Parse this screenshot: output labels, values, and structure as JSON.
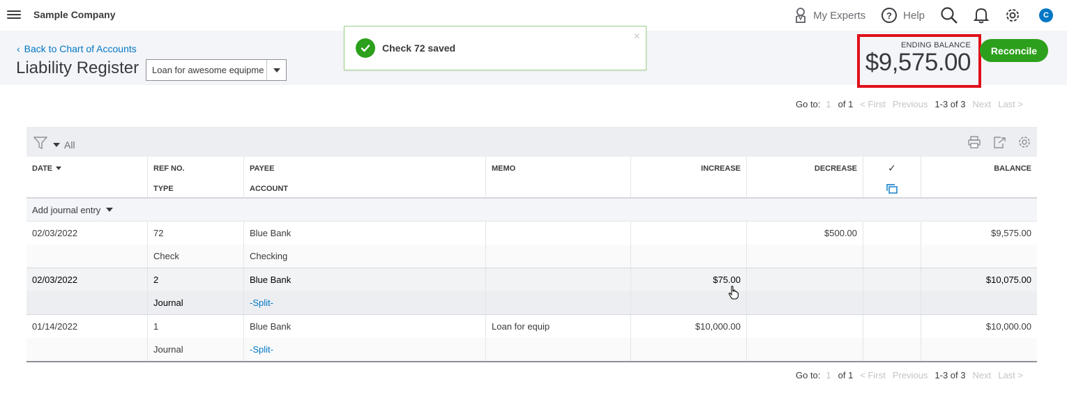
{
  "topbar": {
    "company": "Sample Company",
    "my_experts": "My Experts",
    "help": "Help",
    "avatar_letter": "C"
  },
  "header": {
    "back_link": "Back to Chart of Accounts",
    "title": "Liability Register",
    "account_value": "Loan for awesome equipme"
  },
  "toast": {
    "message": "Check 72 saved",
    "close": "×"
  },
  "balance": {
    "caption": "ENDING BALANCE",
    "amount": "$9,575.00"
  },
  "reconcile_label": "Reconcile",
  "pager": {
    "goto": "Go to:",
    "page": "1",
    "of": "of 1",
    "first": "< First",
    "previous": "Previous",
    "range": "1-3 of 3",
    "next": "Next",
    "last": "Last >"
  },
  "filter": {
    "label": "All"
  },
  "columns": {
    "date": "DATE",
    "ref": "REF NO.",
    "type": "TYPE",
    "payee": "PAYEE",
    "account": "ACCOUNT",
    "memo": "MEMO",
    "increase": "INCREASE",
    "decrease": "DECREASE",
    "check": "✓",
    "balance": "BALANCE"
  },
  "add_journal": "Add journal entry",
  "transactions": [
    {
      "date": "02/03/2022",
      "ref": "72",
      "type": "Check",
      "payee": "Blue Bank",
      "account": "Checking",
      "memo": "",
      "increase": "",
      "decrease": "$500.00",
      "balance": "$9,575.00"
    },
    {
      "date": "02/03/2022",
      "ref": "2",
      "type": "Journal",
      "payee": "Blue Bank",
      "account": "-Split-",
      "memo": "",
      "increase": "$75.00",
      "decrease": "",
      "balance": "$10,075.00"
    },
    {
      "date": "01/14/2022",
      "ref": "1",
      "type": "Journal",
      "payee": "Blue Bank",
      "account": "-Split-",
      "memo": "Loan for equip",
      "increase": "$10,000.00",
      "decrease": "",
      "balance": "$10,000.00"
    }
  ],
  "colors": {
    "accent_green": "#2ca01c",
    "link_blue": "#0077c5",
    "highlight_red": "#e0101a"
  }
}
